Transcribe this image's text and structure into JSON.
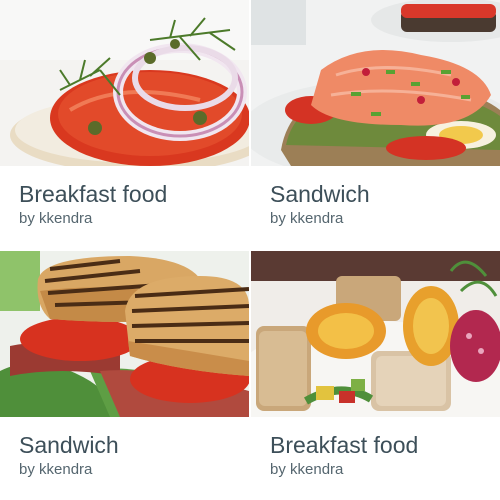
{
  "cards": [
    {
      "title": "Breakfast food",
      "author": "by kkendra",
      "photo_icon": "bagel-lox-tomato-photo"
    },
    {
      "title": "Sandwich",
      "author": "by kkendra",
      "photo_icon": "smoked-salmon-toast-photo"
    },
    {
      "title": "Sandwich",
      "author": "by kkendra",
      "photo_icon": "grilled-blt-sandwich-photo"
    },
    {
      "title": "Breakfast food",
      "author": "by kkendra",
      "photo_icon": "breakfast-bites-plate-photo"
    }
  ],
  "colors": {
    "title": "#3d4f59",
    "author": "#55666f",
    "background": "#ffffff"
  }
}
